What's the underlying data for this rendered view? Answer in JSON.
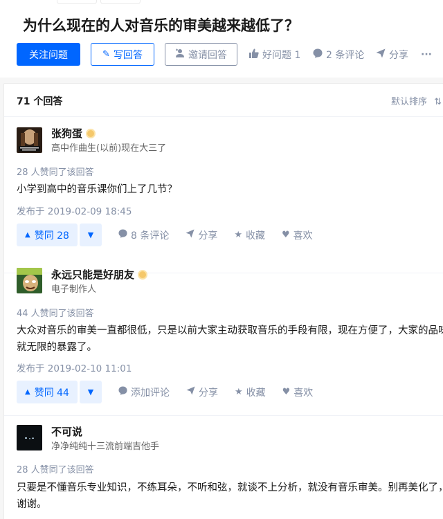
{
  "question": {
    "title": "为什么现在的人对音乐的审美越来越低了？",
    "follow_label": "关注问题",
    "answer_label": "写回答",
    "invite_label": "邀请回答",
    "good_question_label": "好问题 1",
    "comments_label": "2 条评论",
    "share_label": "分享",
    "more_label": "···"
  },
  "list": {
    "count_label": "71 个回答",
    "sort_label": "默认排序"
  },
  "answers": [
    {
      "author": "张狗蛋",
      "headline": "高中作曲生(以前)现在大三了",
      "votes_text": "28 人赞同了该回答",
      "content": "小学到高中的音乐课你们上了几节？",
      "date": "发布于 2019-02-09 18:45",
      "upvote": "赞同 28",
      "comment": "8 条评论",
      "share": "分享",
      "collect": "收藏",
      "like": "喜欢"
    },
    {
      "author": "永远只能是好朋友",
      "headline": "电子制作人",
      "votes_text": "44 人赞同了该回答",
      "content_line1": "大众对音乐的审美一直都很低，只是以前大家主动获取音乐的手段有限，现在方便了，大家的品味",
      "content_line2": "就无限的暴露了。",
      "date": "发布于 2019-02-10 11:01",
      "upvote": "赞同 44",
      "comment": "添加评论",
      "share": "分享",
      "collect": "收藏",
      "like": "喜欢"
    },
    {
      "author": "不可说",
      "headline": "净净纯纯十三流前端吉他手",
      "votes_text": "28 人赞同了该回答",
      "content_line1": "只要是不懂音乐专业知识，不练耳朵，不听和弦，就谈不上分析，就没有音乐审美。别再美化了，",
      "content_line2": "谢谢。"
    }
  ],
  "icons": {
    "pen": "pen-icon",
    "invite": "add-person-icon",
    "thumb": "thumb-up-icon",
    "comment": "comment-bubble-icon",
    "share": "paper-plane-icon",
    "star": "star-icon",
    "heart": "heart-icon"
  },
  "colors": {
    "brand": "#0066ff",
    "muted": "#8590a6",
    "vote_bg": "#e8f1ff"
  }
}
